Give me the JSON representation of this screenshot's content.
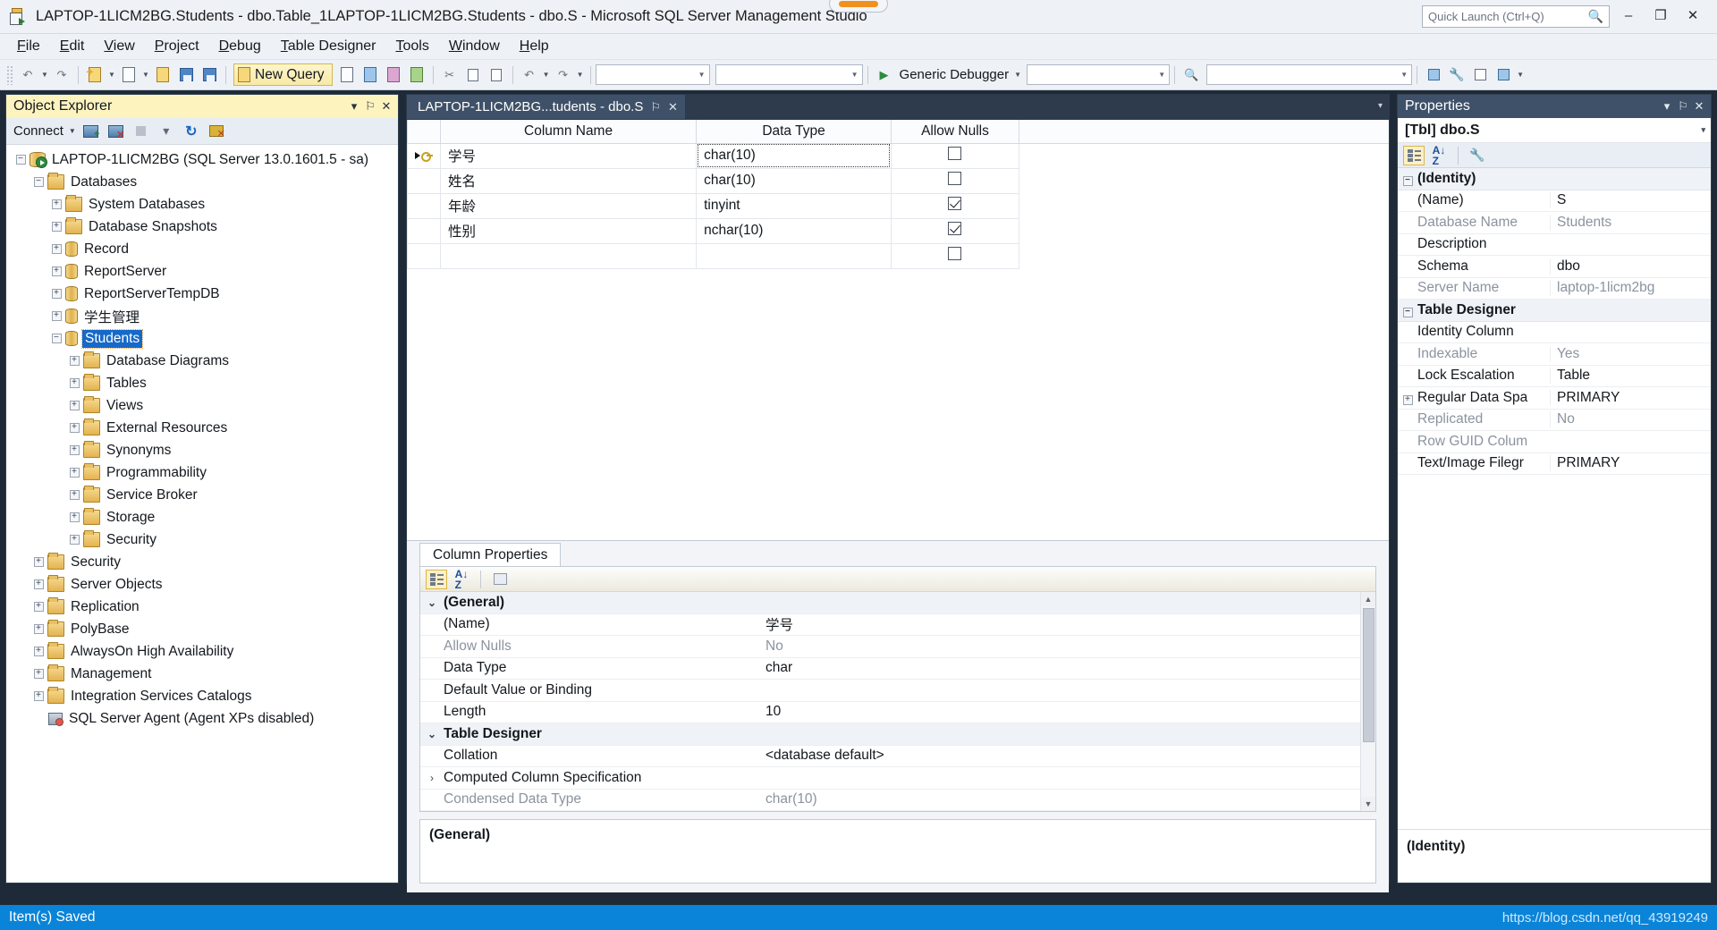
{
  "window": {
    "title": "LAPTOP-1LICM2BG.Students - dbo.Table_1LAPTOP-1LICM2BG.Students - dbo.S - Microsoft SQL Server Management Studio",
    "app_icon": "ssms-icon",
    "minimize": "–",
    "maximize": "❐",
    "close": "✕"
  },
  "quick_launch": {
    "placeholder": "Quick Launch (Ctrl+Q)",
    "icon": "search-icon"
  },
  "menubar": {
    "items": [
      {
        "label": "File",
        "accel": "F"
      },
      {
        "label": "Edit",
        "accel": "E"
      },
      {
        "label": "View",
        "accel": "V"
      },
      {
        "label": "Project",
        "accel": "P"
      },
      {
        "label": "Debug",
        "accel": "D"
      },
      {
        "label": "Table Designer",
        "accel": "T"
      },
      {
        "label": "Tools",
        "accel": "T"
      },
      {
        "label": "Window",
        "accel": "W"
      },
      {
        "label": "Help",
        "accel": "H"
      }
    ]
  },
  "toolbar": {
    "new_query_label": "New Query",
    "debugger_label": "Generic Debugger",
    "combo_blank": ""
  },
  "object_explorer": {
    "title": "Object Explorer",
    "connect_label": "Connect",
    "tools": [
      "connect-server-icon",
      "disconnect-server-icon",
      "stop-icon",
      "filter-icon",
      "refresh-icon",
      "disconnect-all-icon"
    ],
    "panel_buttons": {
      "dropdown": "▾",
      "pin": "⚐",
      "close": "✕"
    },
    "tree": [
      {
        "label": "LAPTOP-1LICM2BG (SQL Server 13.0.1601.5 - sa)",
        "indent": 0,
        "twisty": "minus",
        "icon": "server",
        "selected": false
      },
      {
        "label": "Databases",
        "indent": 1,
        "twisty": "minus",
        "icon": "folder",
        "selected": false
      },
      {
        "label": "System Databases",
        "indent": 2,
        "twisty": "plus",
        "icon": "folder",
        "selected": false
      },
      {
        "label": "Database Snapshots",
        "indent": 2,
        "twisty": "plus",
        "icon": "folder",
        "selected": false
      },
      {
        "label": "Record",
        "indent": 2,
        "twisty": "plus",
        "icon": "db",
        "selected": false
      },
      {
        "label": "ReportServer",
        "indent": 2,
        "twisty": "plus",
        "icon": "db",
        "selected": false
      },
      {
        "label": "ReportServerTempDB",
        "indent": 2,
        "twisty": "plus",
        "icon": "db",
        "selected": false
      },
      {
        "label": "学生管理",
        "indent": 2,
        "twisty": "plus",
        "icon": "db",
        "selected": false
      },
      {
        "label": "Students",
        "indent": 2,
        "twisty": "minus",
        "icon": "db",
        "selected": true
      },
      {
        "label": "Database Diagrams",
        "indent": 3,
        "twisty": "plus",
        "icon": "folder",
        "selected": false
      },
      {
        "label": "Tables",
        "indent": 3,
        "twisty": "plus",
        "icon": "folder",
        "selected": false
      },
      {
        "label": "Views",
        "indent": 3,
        "twisty": "plus",
        "icon": "folder",
        "selected": false
      },
      {
        "label": "External Resources",
        "indent": 3,
        "twisty": "plus",
        "icon": "folder",
        "selected": false
      },
      {
        "label": "Synonyms",
        "indent": 3,
        "twisty": "plus",
        "icon": "folder",
        "selected": false
      },
      {
        "label": "Programmability",
        "indent": 3,
        "twisty": "plus",
        "icon": "folder",
        "selected": false
      },
      {
        "label": "Service Broker",
        "indent": 3,
        "twisty": "plus",
        "icon": "folder",
        "selected": false
      },
      {
        "label": "Storage",
        "indent": 3,
        "twisty": "plus",
        "icon": "folder",
        "selected": false
      },
      {
        "label": "Security",
        "indent": 3,
        "twisty": "plus",
        "icon": "folder",
        "selected": false
      },
      {
        "label": "Security",
        "indent": 1,
        "twisty": "plus",
        "icon": "folder",
        "selected": false
      },
      {
        "label": "Server Objects",
        "indent": 1,
        "twisty": "plus",
        "icon": "folder",
        "selected": false
      },
      {
        "label": "Replication",
        "indent": 1,
        "twisty": "plus",
        "icon": "folder",
        "selected": false
      },
      {
        "label": "PolyBase",
        "indent": 1,
        "twisty": "plus",
        "icon": "folder",
        "selected": false
      },
      {
        "label": "AlwaysOn High Availability",
        "indent": 1,
        "twisty": "plus",
        "icon": "folder",
        "selected": false
      },
      {
        "label": "Management",
        "indent": 1,
        "twisty": "plus",
        "icon": "folder",
        "selected": false
      },
      {
        "label": "Integration Services Catalogs",
        "indent": 1,
        "twisty": "plus",
        "icon": "folder",
        "selected": false
      },
      {
        "label": "SQL Server Agent (Agent XPs disabled)",
        "indent": 1,
        "twisty": "none",
        "icon": "agent",
        "selected": false
      }
    ]
  },
  "document": {
    "tab_label": "LAPTOP-1LICM2BG...tudents - dbo.S",
    "tab_pin": "⚐",
    "tab_close": "✕",
    "strip_caret": "▾",
    "grid": {
      "headers": [
        "Column Name",
        "Data Type",
        "Allow Nulls"
      ],
      "rows": [
        {
          "marker": "key",
          "column_name": "学号",
          "data_type": "char(10)",
          "allow_nulls": false,
          "selected_cell": "data_type"
        },
        {
          "marker": "",
          "column_name": "姓名",
          "data_type": "char(10)",
          "allow_nulls": false,
          "selected_cell": ""
        },
        {
          "marker": "",
          "column_name": "年龄",
          "data_type": "tinyint",
          "allow_nulls": true,
          "selected_cell": ""
        },
        {
          "marker": "",
          "column_name": "性别",
          "data_type": "nchar(10)",
          "allow_nulls": true,
          "selected_cell": ""
        },
        {
          "marker": "",
          "column_name": "",
          "data_type": "",
          "allow_nulls": false,
          "selected_cell": ""
        }
      ]
    }
  },
  "column_properties": {
    "tab_label": "Column Properties",
    "toolbar_icons": [
      "categorized-icon",
      "alphabetical-icon",
      "property-pages-icon"
    ],
    "rows": [
      {
        "kind": "group",
        "name": "(General)",
        "value": "",
        "expander": "⌄",
        "dim": false
      },
      {
        "kind": "item",
        "name": "(Name)",
        "value": "学号",
        "expander": "",
        "dim": false
      },
      {
        "kind": "item",
        "name": "Allow Nulls",
        "value": "No",
        "expander": "",
        "dim": true
      },
      {
        "kind": "item",
        "name": "Data Type",
        "value": "char",
        "expander": "",
        "dim": false
      },
      {
        "kind": "item",
        "name": "Default Value or Binding",
        "value": "",
        "expander": "",
        "dim": false
      },
      {
        "kind": "item",
        "name": "Length",
        "value": "10",
        "expander": "",
        "dim": false
      },
      {
        "kind": "group",
        "name": "Table Designer",
        "value": "",
        "expander": "⌄",
        "dim": false
      },
      {
        "kind": "item",
        "name": "Collation",
        "value": "<database default>",
        "expander": "",
        "dim": false
      },
      {
        "kind": "item",
        "name": "Computed Column Specification",
        "value": "",
        "expander": "›",
        "dim": false
      },
      {
        "kind": "item",
        "name": "Condensed Data Type",
        "value": "char(10)",
        "expander": "",
        "dim": true
      }
    ],
    "description": "(General)",
    "scrollbar": {
      "up": "▲",
      "down": "▼"
    }
  },
  "properties_panel": {
    "title": "Properties",
    "panel_buttons": {
      "dropdown": "▾",
      "pin": "⚐",
      "close": "✕"
    },
    "object_name": "[Tbl] dbo.S",
    "object_caret": "▾",
    "toolbar_icons": [
      "categorized-icon",
      "alphabetical-icon",
      "property-pages-icon"
    ],
    "rows": [
      {
        "kind": "group",
        "name": "(Identity)",
        "value": "",
        "expander": "minus",
        "dim": false
      },
      {
        "kind": "item",
        "name": "(Name)",
        "value": "S",
        "expander": "",
        "dim": false
      },
      {
        "kind": "item",
        "name": "Database Name",
        "value": "Students",
        "expander": "",
        "dim": true
      },
      {
        "kind": "item",
        "name": "Description",
        "value": "",
        "expander": "",
        "dim": false
      },
      {
        "kind": "item",
        "name": "Schema",
        "value": "dbo",
        "expander": "",
        "dim": false
      },
      {
        "kind": "item",
        "name": "Server Name",
        "value": "laptop-1licm2bg",
        "expander": "",
        "dim": true
      },
      {
        "kind": "group",
        "name": "Table Designer",
        "value": "",
        "expander": "minus",
        "dim": false
      },
      {
        "kind": "item",
        "name": "Identity Column",
        "value": "",
        "expander": "",
        "dim": false
      },
      {
        "kind": "item",
        "name": "Indexable",
        "value": "Yes",
        "expander": "",
        "dim": true
      },
      {
        "kind": "item",
        "name": "Lock Escalation",
        "value": "Table",
        "expander": "",
        "dim": false
      },
      {
        "kind": "item",
        "name": "Regular Data Spa",
        "value": "PRIMARY",
        "expander": "plus",
        "dim": false
      },
      {
        "kind": "item",
        "name": "Replicated",
        "value": "No",
        "expander": "",
        "dim": true
      },
      {
        "kind": "item",
        "name": "Row GUID Colum",
        "value": "",
        "expander": "",
        "dim": true
      },
      {
        "kind": "item",
        "name": "Text/Image Filegr",
        "value": "PRIMARY",
        "expander": "",
        "dim": false
      }
    ],
    "description": "(Identity)"
  },
  "statusbar": {
    "text": "Item(s) Saved",
    "watermark": "https://blog.csdn.net/qq_43919249"
  }
}
